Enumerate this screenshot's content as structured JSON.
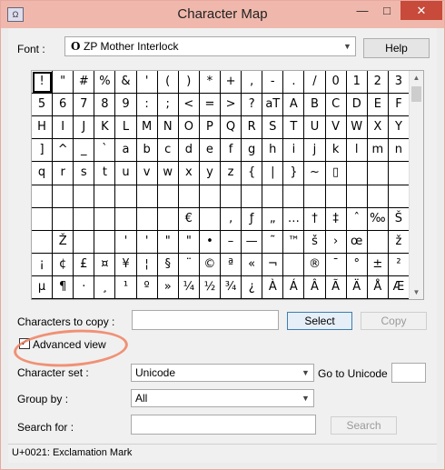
{
  "window": {
    "title": "Character Map",
    "icon": "charmap-app-icon",
    "controls": {
      "minimize": "—",
      "maximize": "□",
      "close": "✕"
    }
  },
  "font": {
    "label": "Font :",
    "value": "ZP Mother Interlock",
    "icon_glyph": "O",
    "help_label": "Help"
  },
  "grid_rows": [
    [
      "!",
      "\"",
      "#",
      "%",
      "&",
      "'",
      "(",
      ")",
      "*",
      "+",
      ",",
      "-",
      ".",
      "/",
      "0",
      "1",
      "2",
      "3",
      "4"
    ],
    [
      "5",
      "6",
      "7",
      "8",
      "9",
      ":",
      ";",
      "<",
      "=",
      ">",
      "?",
      "aT",
      "A",
      "B",
      "C",
      "D",
      "E",
      "F",
      "G"
    ],
    [
      "H",
      "I",
      "J",
      "K",
      "L",
      "M",
      "N",
      "O",
      "P",
      "Q",
      "R",
      "S",
      "T",
      "U",
      "V",
      "W",
      "X",
      "Y",
      "Z",
      "[",
      "\\"
    ],
    [
      "]",
      "^",
      "_",
      "`",
      "a",
      "b",
      "c",
      "d",
      "e",
      "f",
      "g",
      "h",
      "i",
      "j",
      "k",
      "l",
      "m",
      "n",
      "o",
      "p"
    ],
    [
      "q",
      "r",
      "s",
      "t",
      "u",
      "v",
      "w",
      "x",
      "y",
      "z",
      "{",
      "|",
      "}",
      "~",
      "▯",
      "",
      "",
      "",
      ""
    ],
    [
      "",
      "",
      "",
      "",
      "",
      "",
      "",
      "",
      "",
      "",
      "",
      "",
      "",
      "",
      "",
      "",
      "",
      "",
      ""
    ],
    [
      "",
      "",
      "",
      "",
      "",
      "",
      "",
      "€",
      "",
      "‚",
      "ƒ",
      "„",
      "…",
      "†",
      "‡",
      "ˆ",
      "‰",
      "Š",
      "‹",
      "Œ"
    ],
    [
      "",
      "Ž",
      "",
      "",
      "'",
      "'",
      "\"",
      "\"",
      "•",
      "–",
      "—",
      "˜",
      "™",
      "š",
      "›",
      "œ",
      "",
      "ž",
      "Ÿ"
    ],
    [
      "¡",
      "¢",
      "£",
      "¤",
      "¥",
      "¦",
      "§",
      "¨",
      "©",
      "ª",
      "«",
      "¬",
      "",
      "®",
      "¯",
      "°",
      "±",
      "²",
      "³",
      "´"
    ],
    [
      "µ",
      "¶",
      "·",
      "¸",
      "¹",
      "º",
      "»",
      "¼",
      "½",
      "¾",
      "¿",
      "À",
      "Á",
      "Â",
      "Ã",
      "Ä",
      "Å",
      "Æ",
      "Ç",
      "È"
    ]
  ],
  "copy": {
    "label": "Characters to copy :",
    "value": "",
    "select_label": "Select",
    "copy_label": "Copy"
  },
  "advanced": {
    "label": "Advanced view",
    "checked": true
  },
  "charset": {
    "label": "Character set :",
    "value": "Unicode",
    "goto_label": "Go to Unicode :",
    "goto_value": ""
  },
  "groupby": {
    "label": "Group by :",
    "value": "All"
  },
  "search": {
    "label": "Search for :",
    "value": "",
    "button_label": "Search"
  },
  "status": {
    "text": "U+0021: Exclamation Mark"
  }
}
